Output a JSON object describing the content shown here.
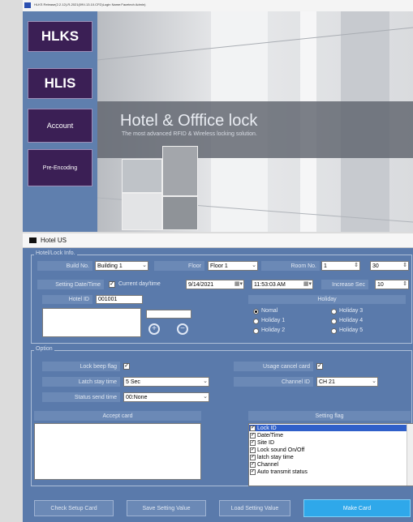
{
  "top_window": {
    "title": "HLKS Release(2.2.12)-R-2021(09V-13.10.CFD)Login Name:Facetech Admin)",
    "nav": [
      "HLKS",
      "HLIS",
      "Account",
      "Pre-Encoding"
    ],
    "hero_title": "Hotel & Offfice lock",
    "hero_subtitle": "The most advanced RFID & Wireless locking solution."
  },
  "hotel_window": {
    "title": "Hotel US",
    "lock_info": {
      "group_label": "Hotel/Lock Info.",
      "build_no_label": "Build No.",
      "build_no_value": "Building 1",
      "floor_label": "Floor",
      "floor_value": "Floor 1",
      "room_no_label": "Room No.",
      "room_from": "1",
      "room_to": "30",
      "setting_datetime_label": "Setting Date/Time",
      "current_daytime_label": "Current day/time",
      "date_value": "9/14/2021",
      "time_value": "11:53:03 AM",
      "increase_sec_label": "Increase Sec",
      "increase_sec_value": "10",
      "hotel_id_label": "Hotel ID",
      "hotel_id_value": "001001",
      "holiday_label": "Holiday",
      "holiday_options": [
        "Nomal",
        "Holiday 1",
        "Holiday 2",
        "Holiday 3",
        "Holiday 4",
        "Holiday 5"
      ],
      "holiday_selected": "Nomal"
    },
    "option": {
      "group_label": "Option",
      "lock_beep_label": "Lock beep flag",
      "usage_cancel_label": "Usage cancel card",
      "latch_stay_label": "Latch stay time",
      "latch_stay_value": "5 Sec",
      "channel_id_label": "Channel ID",
      "channel_id_value": "CH 21",
      "status_send_label": "Status send time",
      "status_send_value": "00:None",
      "accept_card_label": "Accept card",
      "setting_flag_label": "Setting flag",
      "flags": [
        "Lock ID",
        "Date/Time",
        "Site ID",
        "Lock sound On/Off",
        "latch stay time",
        "Channel",
        "Auto transmit status"
      ]
    },
    "buttons": {
      "check_setup": "Check Setup Card",
      "save_setting": "Save Setting Value",
      "load_setting": "Load Setting Value",
      "make_card": "Make Card"
    }
  }
}
